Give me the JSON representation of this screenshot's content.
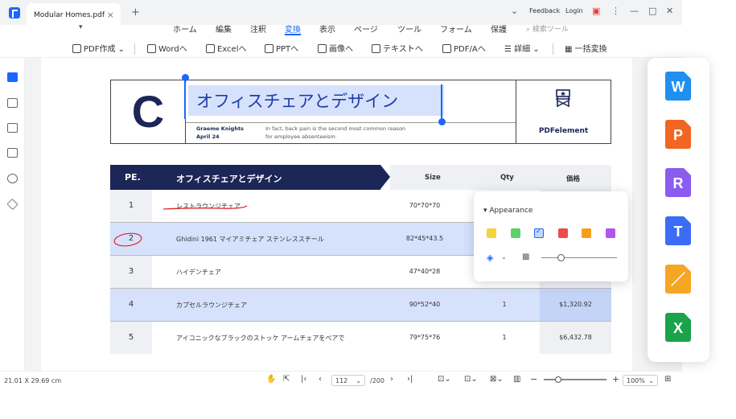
{
  "tab": {
    "title": "Modular Homes.pdf"
  },
  "window": {
    "feedback": "Feedback",
    "login": "Login"
  },
  "menu": [
    "ホーム",
    "編集",
    "注釈",
    "変換",
    "表示",
    "ページ",
    "ツール",
    "フォーム",
    "保護"
  ],
  "menu_active": "変換",
  "search": {
    "placeholder": "検索ツール"
  },
  "toolbar": {
    "pdf_create": "PDF作成",
    "word": "Wordへ",
    "excel": "Excelへ",
    "ppt": "PPTへ",
    "image": "画像へ",
    "text": "テキストへ",
    "pdfa": "PDF/Aへ",
    "more": "詳細",
    "batch": "一括変換"
  },
  "doc": {
    "logo_letter": "C",
    "title": "オフィスチェアとデザイン",
    "author": "Graeme Knights",
    "date": "April 24",
    "desc_line1": "In fact, back pain is the second most common reason",
    "desc_line2": "for employee absenteeism.",
    "brand": "PDFelement"
  },
  "table": {
    "headers": {
      "no": "PE.",
      "name": "オフィスチェアとデザイン",
      "size": "Size",
      "qty": "Qty",
      "price": "価格"
    },
    "rows": [
      {
        "no": "1",
        "name": "レストラウンジチェア",
        "size": "70*70*70",
        "qty": "",
        "price": ""
      },
      {
        "no": "2",
        "name": "Ghidini 1961 マイアミチェア ステンレススチール",
        "size": "82*45*43.5",
        "qty": "",
        "price": ""
      },
      {
        "no": "3",
        "name": "ハイデンチェア",
        "size": "47*40*28",
        "qty": "",
        "price": ""
      },
      {
        "no": "4",
        "name": "カプセルラウンジチェア",
        "size": "90*52*40",
        "qty": "1",
        "price": "$1,320.92"
      },
      {
        "no": "5",
        "name": "アイコニックなブラックのストッケ アームチェアをペアで",
        "size": "79*75*76",
        "qty": "1",
        "price": "$6,432.78"
      }
    ]
  },
  "appearance": {
    "title": "Appearance",
    "colors": [
      "#f5d33b",
      "#5bd16a",
      "#c5d8fb",
      "#ee4a4a",
      "#f59e1b",
      "#b553f0"
    ],
    "selected_color_index": 2,
    "opacity": 0.26
  },
  "status": {
    "dimensions": "21.01 X 29.69 cm",
    "page": "112",
    "total": "/200",
    "zoom": "100%",
    "zoom_level": 0.23
  },
  "convert_formats": [
    {
      "letter": "W",
      "color": "#1f8ff0",
      "name": "word-icon"
    },
    {
      "letter": "P",
      "color": "#f26522",
      "name": "powerpoint-icon"
    },
    {
      "letter": "R",
      "color": "#8a5cf0",
      "name": "rtf-icon"
    },
    {
      "letter": "T",
      "color": "#3a6cf5",
      "name": "text-icon"
    },
    {
      "letter": "／",
      "color": "#f5a623",
      "name": "pages-icon"
    },
    {
      "letter": "X",
      "color": "#1aa34a",
      "name": "excel-icon"
    }
  ]
}
